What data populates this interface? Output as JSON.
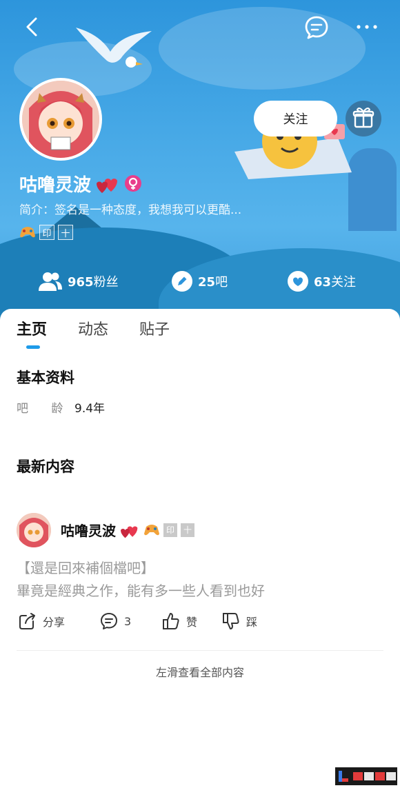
{
  "profile": {
    "name": "咕噜灵波",
    "follow_label": "关注",
    "bio": "简介：签名是一种态度，我想我可以更酷...",
    "badges": [
      "印",
      "十"
    ]
  },
  "stats": {
    "fans_count": "965",
    "fans_label": "粉丝",
    "bars_count": "25",
    "bars_label": "吧",
    "following_count": "63",
    "following_label": "关注"
  },
  "tabs": [
    {
      "label": "主页",
      "active": true
    },
    {
      "label": "动态",
      "active": false
    },
    {
      "label": "贴子",
      "active": false
    }
  ],
  "basic_info": {
    "title": "基本资料",
    "age_label": "吧 龄",
    "age_value": "9.4年"
  },
  "latest": {
    "title": "最新内容",
    "post": {
      "author": "咕噜灵波",
      "badges": [
        "印",
        "十"
      ],
      "line1": "【還是回來補個檔吧】",
      "line2": "畢竟是經典之作，能有多一些人看到也好",
      "actions": {
        "share": "分享",
        "comment": "3",
        "like": "赞",
        "dislike": "踩"
      }
    },
    "more_link": "左滑查看全部内容"
  },
  "colors": {
    "header_blue": "#2d95dc",
    "tab_accent": "#1e9be9",
    "gender_badge": "#e83e8c"
  }
}
